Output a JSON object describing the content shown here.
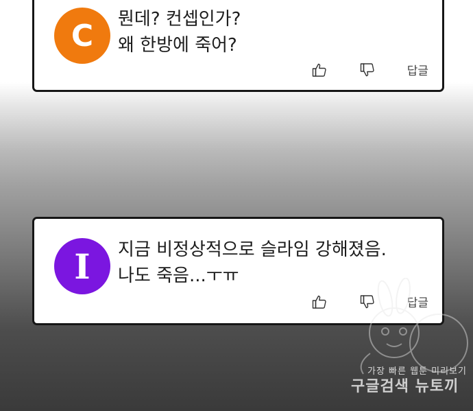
{
  "colors": {
    "avatar_c": "#f07a0e",
    "avatar_i": "#7b16e0",
    "card_border": "#161616"
  },
  "comments": [
    {
      "avatar_letter": "C",
      "lines": [
        "뭔데? 컨셉인가?",
        "왜 한방에 죽어?"
      ],
      "like_icon": "thumbs-up-icon",
      "dislike_icon": "thumbs-down-icon",
      "reply_label": "답글"
    },
    {
      "avatar_letter": "I",
      "lines": [
        "지금 비정상적으로 슬라임 강해졌음.",
        "나도 죽음...ㅜㅠ"
      ],
      "like_icon": "thumbs-up-icon",
      "dislike_icon": "thumbs-down-icon",
      "reply_label": "답글"
    }
  ],
  "watermark": {
    "line1": "가장 빠른 웹툰 미리보기",
    "line2": "구글검색 뉴토끼"
  }
}
